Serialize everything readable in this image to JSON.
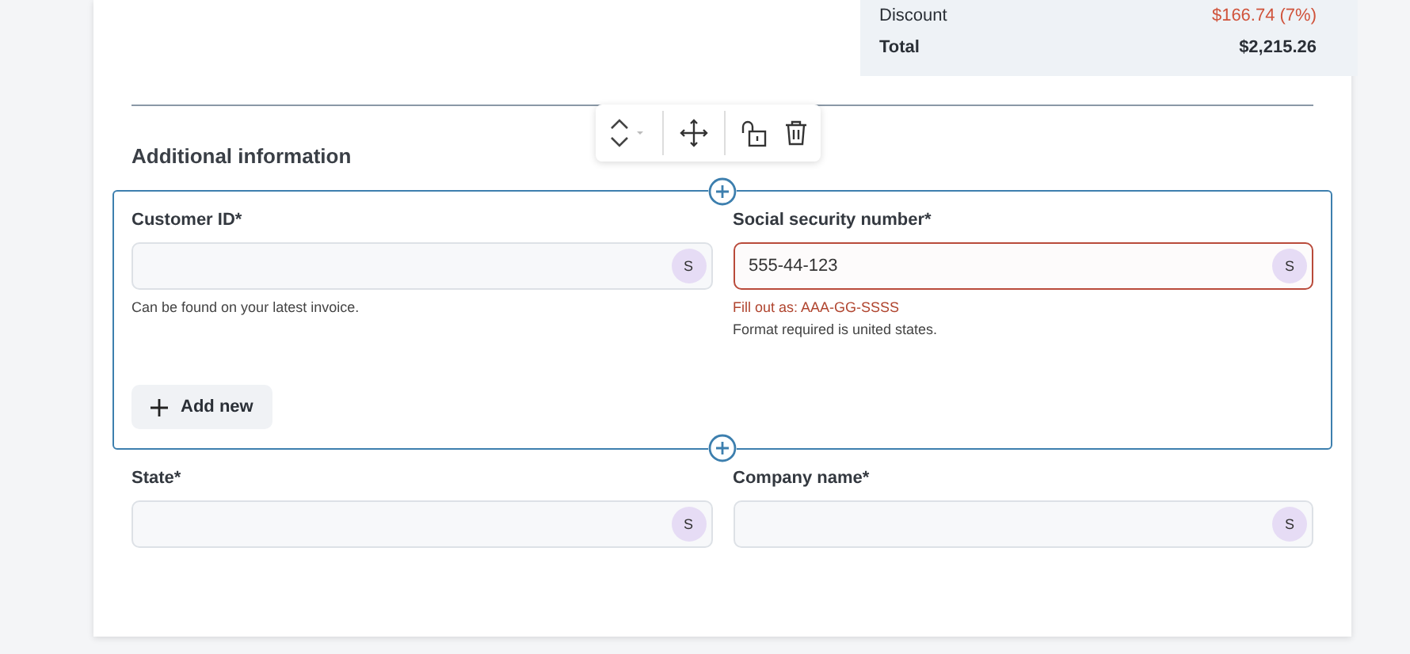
{
  "summary": [
    {
      "kind": "discount",
      "label": "Discount",
      "value": "$166.74 (7%)"
    },
    {
      "kind": "total",
      "label": "Total",
      "value": "$2,215.26"
    }
  ],
  "section": {
    "title": "Additional information",
    "selected": true,
    "fields": [
      {
        "label": "Customer ID*",
        "badge": "S",
        "invalid": false,
        "messages": [
          {
            "kind": "hint",
            "text": "Can be found on your latest invoice."
          }
        ]
      },
      {
        "label": "Social security number*",
        "value": "555-44-123",
        "badge": "S",
        "invalid": true,
        "messages": [
          {
            "kind": "error",
            "text": "Fill out as: AAA-GG-SSSS"
          },
          {
            "kind": "hint",
            "text": "Format required is united states."
          }
        ]
      }
    ],
    "add_button": "Add new"
  },
  "fields": [
    {
      "label": "State*",
      "badge": "S",
      "invalid": false
    },
    {
      "label": "Company name*",
      "badge": "S",
      "invalid": false
    }
  ]
}
